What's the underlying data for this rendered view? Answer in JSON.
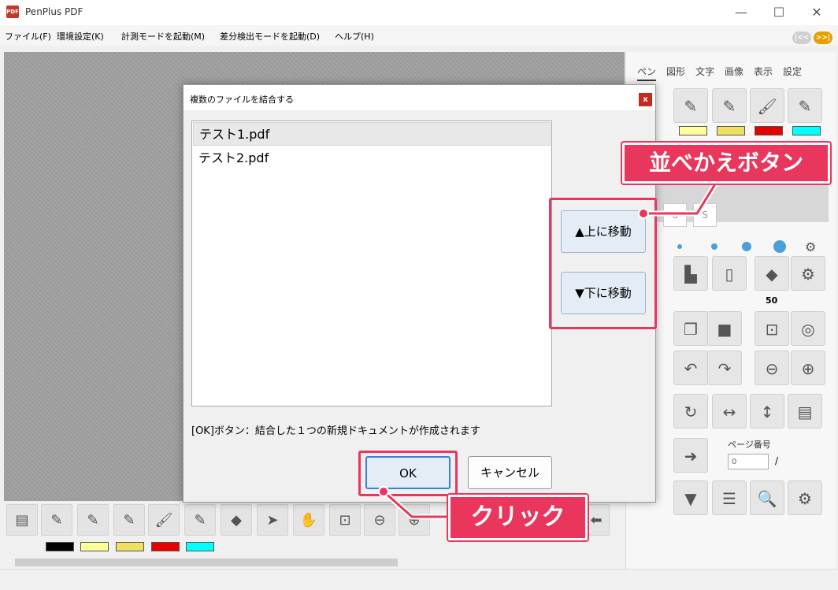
{
  "app": {
    "icon_text": "PDF",
    "title": "PenPlus PDF"
  },
  "window_controls": {
    "minimize": "—",
    "maximize": "☐",
    "close": "✕"
  },
  "menu": [
    "ファイル(F)",
    "環境設定(K)",
    "計測モードを起動(M)",
    "差分検出モードを起動(D)",
    "ヘルプ(H)"
  ],
  "nav_pills": {
    "prev": "|<<",
    "next": ">>|"
  },
  "right_panel": {
    "tabs": [
      "ペン",
      "図形",
      "文字",
      "画像",
      "表示",
      "設定"
    ],
    "value_50": "50",
    "page_label": "ページ番号",
    "page_value": "0",
    "page_separator": "/"
  },
  "swatch_colors": [
    "#000000",
    "#ffff99",
    "#f0e060",
    "#e60000",
    "#00ffff"
  ],
  "dialog": {
    "title": "複数のファイルを結合する",
    "close": "x",
    "files": [
      "テスト1.pdf",
      "テスト2.pdf"
    ],
    "move_up": "▲上に移動",
    "move_down": "▼下に移動",
    "note": "[OK]ボタン：結合した１つの新規ドキュメントが作成されます",
    "ok": "OK",
    "cancel": "キャンセル"
  },
  "annotations": {
    "reorder_callout": "並べかえボタン",
    "click_callout": "クリック",
    "accent": "#e8365d"
  }
}
